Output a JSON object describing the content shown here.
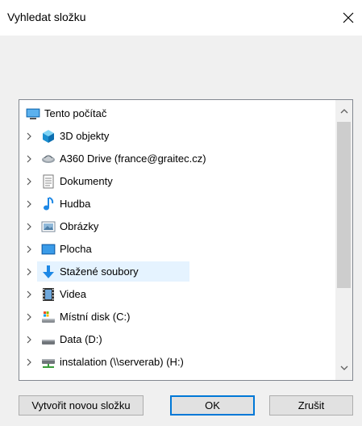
{
  "dialog": {
    "title": "Vyhledat složku"
  },
  "tree": {
    "items": [
      {
        "label": "Tento počítač",
        "icon": "computer-icon",
        "expandable": false
      },
      {
        "label": "3D objekty",
        "icon": "3d-objects-icon",
        "expandable": true
      },
      {
        "label": "A360 Drive (france@graitec.cz)",
        "icon": "a360-drive-icon",
        "expandable": true
      },
      {
        "label": "Dokumenty",
        "icon": "documents-icon",
        "expandable": true
      },
      {
        "label": "Hudba",
        "icon": "music-icon",
        "expandable": true
      },
      {
        "label": "Obrázky",
        "icon": "pictures-icon",
        "expandable": true
      },
      {
        "label": "Plocha",
        "icon": "desktop-icon",
        "expandable": true
      },
      {
        "label": "Stažené soubory",
        "icon": "downloads-icon",
        "expandable": true,
        "highlighted": true
      },
      {
        "label": "Videa",
        "icon": "videos-icon",
        "expandable": true
      },
      {
        "label": "Místní disk (C:)",
        "icon": "local-disk-icon",
        "expandable": true
      },
      {
        "label": "Data (D:)",
        "icon": "drive-icon",
        "expandable": true
      },
      {
        "label": "instalation (\\\\serverab) (H:)",
        "icon": "network-drive-icon",
        "expandable": true
      }
    ]
  },
  "buttons": {
    "new_folder": "Vytvořit novou složku",
    "ok": "OK",
    "cancel": "Zrušit"
  },
  "colors": {
    "accent": "#0078d7",
    "hover_highlight": "#e5f3ff",
    "dialog_bg": "#f0f0f0"
  }
}
